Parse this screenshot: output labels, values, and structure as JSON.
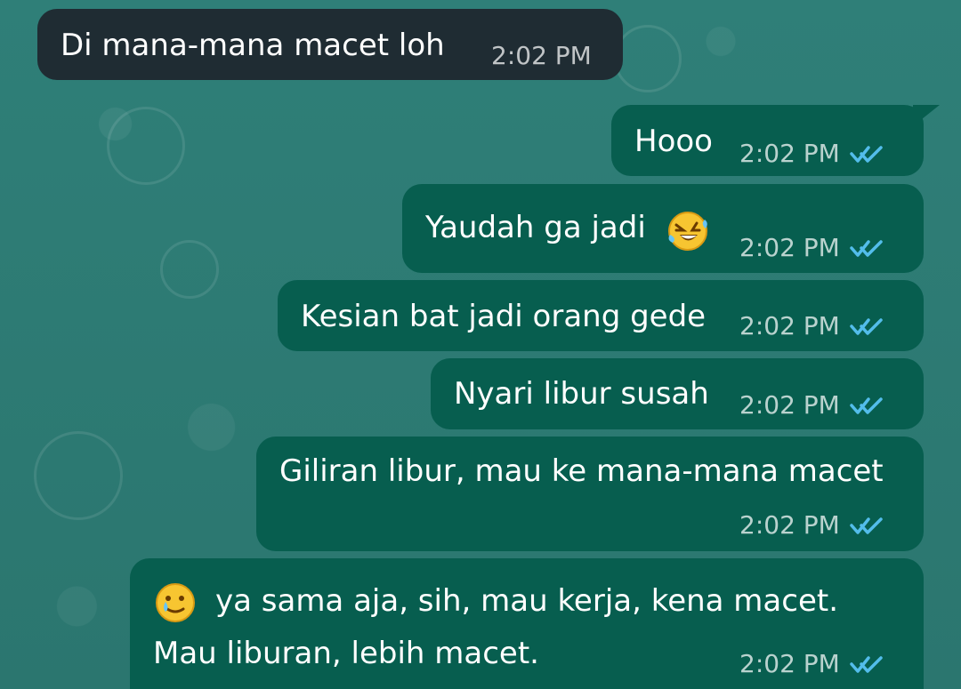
{
  "chat": {
    "messages": [
      {
        "direction": "incoming",
        "text": "Di mana-mana macet loh",
        "time": "2:02 PM"
      },
      {
        "direction": "outgoing",
        "text": "Hooo",
        "time": "2:02 PM",
        "status": "read"
      },
      {
        "direction": "outgoing",
        "text": "Yaudah ga jadi",
        "emoji": "rolling-on-floor-laughing",
        "time": "2:02 PM",
        "status": "read"
      },
      {
        "direction": "outgoing",
        "text": "Kesian bat jadi orang gede",
        "time": "2:02 PM",
        "status": "read"
      },
      {
        "direction": "outgoing",
        "text": "Nyari libur susah",
        "time": "2:02 PM",
        "status": "read"
      },
      {
        "direction": "outgoing",
        "text": "Giliran libur, mau ke mana-mana macet",
        "time": "2:02 PM",
        "status": "read"
      },
      {
        "direction": "outgoing",
        "text_line1": "ya sama aja, sih, mau kerja, kena macet.",
        "text_line2": "Mau liburan, lebih macet.",
        "emoji": "face-holding-back-tears",
        "time": "2:02 PM",
        "status": "read"
      }
    ]
  },
  "colors": {
    "wallpaper": "#2f7f78",
    "incoming_bubble": "#1f2c33",
    "outgoing_bubble": "#075e4f",
    "read_ticks": "#53bdeb"
  }
}
